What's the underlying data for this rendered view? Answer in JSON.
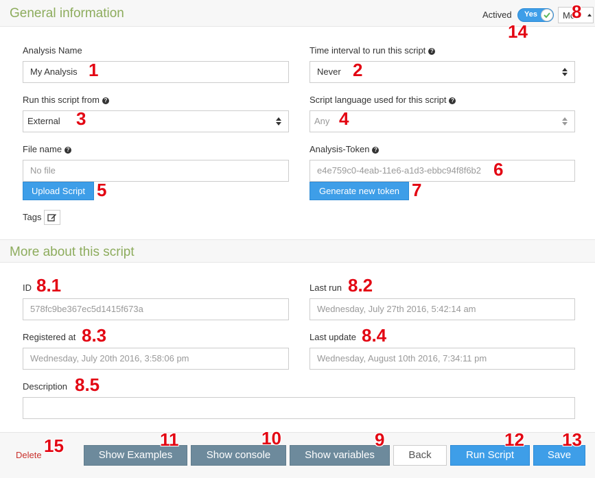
{
  "general": {
    "title": "General information",
    "actived_label": "Actived",
    "toggle_label": "Yes",
    "more_label": "Mo",
    "analysis_name_label": "Analysis Name",
    "analysis_name_value": "My Analysis",
    "interval_label": "Time interval to run this script",
    "interval_value": "Never",
    "run_from_label": "Run this script from",
    "run_from_value": "External",
    "language_label": "Script language used for this script",
    "language_value": "Any",
    "file_name_label": "File name",
    "file_name_placeholder": "No file",
    "token_label": "Analysis-Token",
    "token_value": "e4e759c0-4eab-11e6-a1d3-ebbc94f8f6b2",
    "upload_button": "Upload Script",
    "generate_token_button": "Generate new token",
    "tags_label": "Tags"
  },
  "more": {
    "title": "More about this script",
    "id_label": "ID",
    "id_value": "578fc9be367ec5d1415f673a",
    "last_run_label": "Last run",
    "last_run_value": "Wednesday, July 27th 2016, 5:42:14 am",
    "registered_label": "Registered at",
    "registered_value": "Wednesday, July 20th 2016, 3:58:06 pm",
    "last_update_label": "Last update",
    "last_update_value": "Wednesday, August 10th 2016, 7:34:11 pm",
    "description_label": "Description",
    "description_value": ""
  },
  "footer": {
    "delete": "Delete",
    "show_examples": "Show Examples",
    "show_console": "Show console",
    "show_variables": "Show variables",
    "back": "Back",
    "run_script": "Run Script",
    "save": "Save"
  },
  "annotations": {
    "n1": "1",
    "n2": "2",
    "n3": "3",
    "n4": "4",
    "n5": "5",
    "n6": "6",
    "n7": "7",
    "n8": "8",
    "n81": "8.1",
    "n82": "8.2",
    "n83": "8.3",
    "n84": "8.4",
    "n85": "8.5",
    "n9": "9",
    "n10": "10",
    "n11": "11",
    "n12": "12",
    "n13": "13",
    "n14": "14",
    "n15": "15"
  },
  "colors": {
    "section_title": "#8dac5d",
    "primary": "#3e9ee8",
    "secondary": "#6d8a9c",
    "annotation": "#e30613",
    "delete": "#c9302c"
  },
  "icons": {
    "help": "question-circle-icon",
    "tags_edit": "edit-icon",
    "toggle_check": "check-icon",
    "more_caret": "caret-up-icon",
    "select_arrows": "sort-arrows-icon"
  }
}
